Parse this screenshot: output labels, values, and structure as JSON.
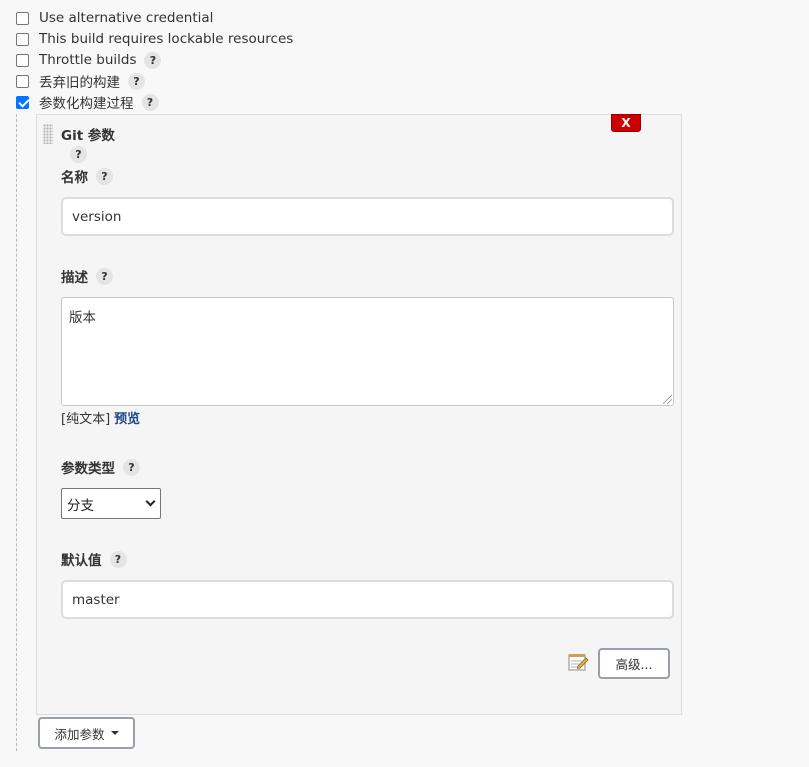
{
  "options": [
    {
      "label": "Use alternative credential",
      "checked": false,
      "help": false
    },
    {
      "label": "This build requires lockable resources",
      "checked": false,
      "help": false
    },
    {
      "label": "Throttle builds",
      "checked": false,
      "help": true
    },
    {
      "label": "丢弃旧的构建",
      "checked": false,
      "help": true
    },
    {
      "label": "参数化构建过程",
      "checked": true,
      "help": true
    }
  ],
  "help_mark": "?",
  "param_panel": {
    "title": "Git 参数",
    "remove_label": "X",
    "name": {
      "label": "名称",
      "value": "version"
    },
    "description": {
      "label": "描述",
      "value": "版本"
    },
    "plain_text_label": "[纯文本]",
    "preview_label": "预览",
    "param_type": {
      "label": "参数类型",
      "selected": "分支"
    },
    "default_value": {
      "label": "默认值",
      "value": "master"
    },
    "advanced_label": "高级..."
  },
  "add_param_label": "添加参数",
  "icons": [
    "drag-handle-icon",
    "help-icon",
    "notepad-icon",
    "chevron-down-icon",
    "caret-down-icon"
  ]
}
